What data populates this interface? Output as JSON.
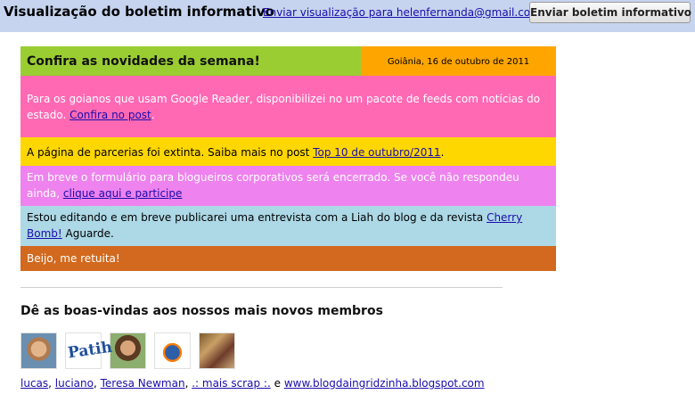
{
  "topbar": {
    "title": "Visualização do boletim informativo",
    "preview_link": "Enviar visualização para helenfernanda@gmail.com",
    "send_button": "Enviar boletim informativo"
  },
  "newsletter": {
    "headline": "Confira as novidades da semana!",
    "date": "Goiânia, 16 de outubro de 2011",
    "block1": {
      "text": "Para os goianos que usam Google Reader, disponibilizei no um pacote de feeds com notícias do estado. ",
      "link": "Confira no post",
      "after": "."
    },
    "block2": {
      "text": "A página de parcerias foi extinta. Saiba mais no post ",
      "link": "Top 10 de outubro/2011",
      "after": "."
    },
    "block3": {
      "text": "Em breve o formulário para blogueiros corporativos será encerrado. Se você não respondeu ainda, ",
      "link": "clique aqui e participe"
    },
    "block4": {
      "text": "Estou editando e em breve publicarei uma entrevista com a Liah do blog e da revista ",
      "link": "Cherry Bomb!",
      "after": " Aguarde."
    },
    "block5": {
      "text": "Beijo, me retuita!"
    }
  },
  "members": {
    "title": "Dê as boas-vindas aos nossos mais novos membros",
    "avatar2_text": "Patih",
    "names": [
      "lucas",
      "luciano",
      "Teresa Newman",
      ".: mais scrap :.",
      "www.blogdaingridzinha.blogspot.com"
    ],
    "conjunction": "e"
  },
  "colors": {
    "topbar": "#c6d4ef",
    "headline_bg": "#9acd32",
    "date_bg": "#ffa500",
    "block1_bg": "#ff69b4",
    "block2_bg": "#ffd700",
    "block3_bg": "#ee82ee",
    "block4_bg": "#add8e6",
    "block5_bg": "#d2691e",
    "link": "#1a0dab"
  }
}
